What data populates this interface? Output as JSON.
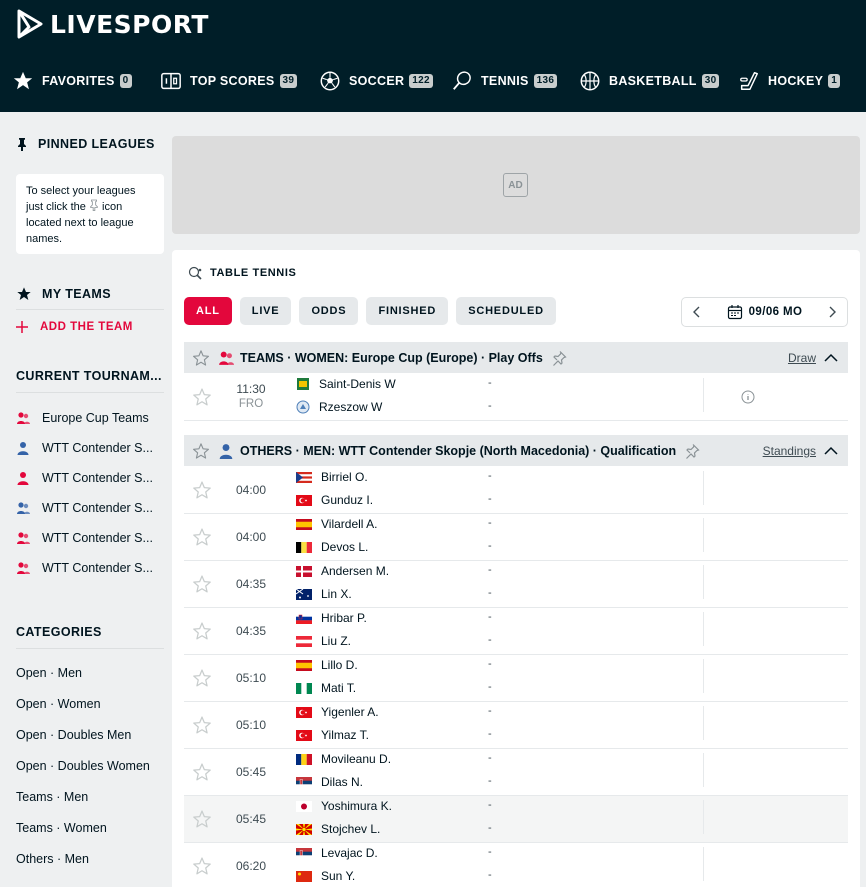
{
  "brand": {
    "name": "LIVESPORT"
  },
  "nav": [
    {
      "label": "FAVORITES",
      "count": "0",
      "icon": "star-icon"
    },
    {
      "label": "TOP SCORES",
      "count": "39",
      "icon": "scoreboard-icon"
    },
    {
      "label": "SOCCER",
      "count": "122",
      "icon": "soccer-ball-icon"
    },
    {
      "label": "TENNIS",
      "count": "136",
      "icon": "tennis-racket-icon"
    },
    {
      "label": "BASKETBALL",
      "count": "30",
      "icon": "basketball-icon"
    },
    {
      "label": "HOCKEY",
      "count": "1",
      "icon": "hockey-stick-icon"
    }
  ],
  "sidebar": {
    "pinned_title": "PINNED LEAGUES",
    "pinned_help_before": "To select your leagues just click the",
    "pinned_help_after": "icon located next to league names.",
    "my_teams": "MY TEAMS",
    "add_team": "ADD THE TEAM",
    "current_title": "CURRENT TOURNAM...",
    "tournaments": [
      {
        "label": "Europe Cup Teams",
        "icon": "teams-women-icon"
      },
      {
        "label": "WTT Contender S...",
        "icon": "man-icon"
      },
      {
        "label": "WTT Contender S...",
        "icon": "woman-icon"
      },
      {
        "label": "WTT Contender S...",
        "icon": "doubles-men-icon"
      },
      {
        "label": "WTT Contender S...",
        "icon": "doubles-women-icon"
      },
      {
        "label": "WTT Contender S...",
        "icon": "doubles-women-icon"
      }
    ],
    "categories_title": "CATEGORIES",
    "categories": [
      "Open · Men",
      "Open · Women",
      "Open · Doubles Men",
      "Open · Doubles Women",
      "Teams · Men",
      "Teams · Women",
      "Others · Men"
    ]
  },
  "ad": {
    "label": "AD"
  },
  "main": {
    "sport": "TABLE TENNIS",
    "filters": [
      "ALL",
      "LIVE",
      "ODDS",
      "FINISHED",
      "SCHEDULED"
    ],
    "date": "09/06 MO",
    "leagues": [
      {
        "country": "TEAMS",
        "name": "WOMEN: Europe Cup (Europe) · Play Offs",
        "link": "Draw",
        "matches": [
          {
            "time": "11:30",
            "status": "FRO",
            "home": "Saint-Denis W",
            "away": "Rzeszow W",
            "home_score": "-",
            "away_score": "-"
          }
        ]
      },
      {
        "country": "OTHERS",
        "name": "MEN: WTT Contender Skopje (North Macedonia) · Qualification",
        "link": "Standings",
        "matches": [
          {
            "time": "04:00",
            "home": "Birriel O.",
            "away": "Gunduz I.",
            "home_score": "-",
            "away_score": "-"
          },
          {
            "time": "04:00",
            "home": "Vilardell A.",
            "away": "Devos L.",
            "home_score": "-",
            "away_score": "-"
          },
          {
            "time": "04:35",
            "home": "Andersen M.",
            "away": "Lin X.",
            "home_score": "-",
            "away_score": "-"
          },
          {
            "time": "04:35",
            "home": "Hribar P.",
            "away": "Liu Z.",
            "home_score": "-",
            "away_score": "-"
          },
          {
            "time": "05:10",
            "home": "Lillo D.",
            "away": "Mati T.",
            "home_score": "-",
            "away_score": "-"
          },
          {
            "time": "05:10",
            "home": "Yigenler A.",
            "away": "Yilmaz T.",
            "home_score": "-",
            "away_score": "-"
          },
          {
            "time": "05:45",
            "home": "Movileanu D.",
            "away": "Dilas N.",
            "home_score": "-",
            "away_score": "-"
          },
          {
            "time": "05:45",
            "home": "Yoshimura K.",
            "away": "Stojchev L.",
            "home_score": "-",
            "away_score": "-"
          },
          {
            "time": "06:20",
            "home": "Levajac D.",
            "away": "Sun Y.",
            "home_score": "-",
            "away_score": "-"
          }
        ]
      }
    ]
  },
  "colors": {
    "header_bg": "#001e28",
    "accent": "#e3073c",
    "page_bg": "#eef0f1"
  }
}
